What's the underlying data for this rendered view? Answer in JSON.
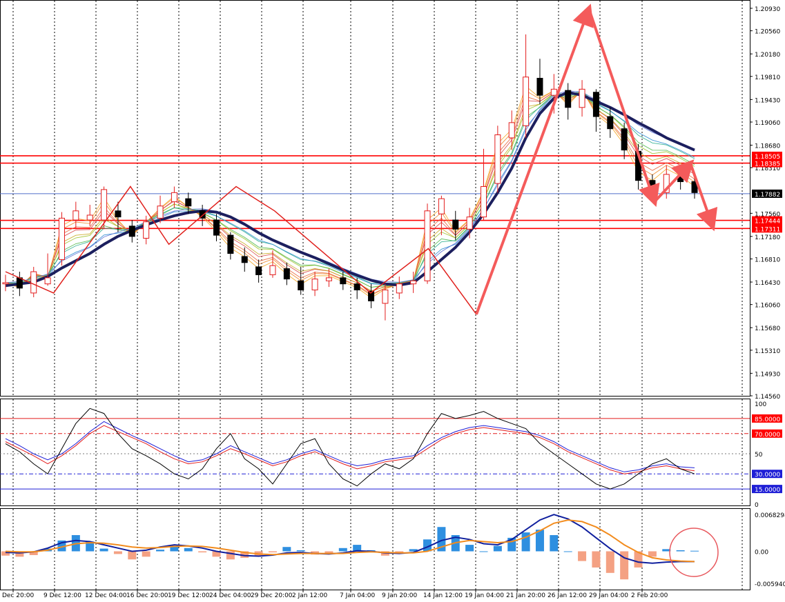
{
  "colors": {
    "background": "#ffffff",
    "panel_border": "#000000",
    "grid": "#000000",
    "resistance_line": "#ff0000",
    "price_line": "#4f6cc9",
    "trend_ma": "#1c1f5e",
    "pattern_lines": "#e0201c",
    "forecast_arrows": "#f45b5b",
    "bull_candle": "#e31b1b",
    "bear_candle": "#000000",
    "macd_positive_hist": "#2e8fe0",
    "macd_negative_hist": "#f4a183",
    "macd_line": "#0f1f9e",
    "signal_line": "#f28c1e",
    "stoch_main": "#000000",
    "stoch_blue": "#1e1ed6",
    "stoch_red": "#e31b1b",
    "highlight_circle": "#e8585d"
  },
  "price_axis": {
    "ticks": [
      "1.20930",
      "1.20560",
      "1.20180",
      "1.19810",
      "1.19430",
      "1.19060",
      "1.18680",
      "1.18310",
      "1.17560",
      "1.17180",
      "1.16810",
      "1.16430",
      "1.16060",
      "1.15680",
      "1.15310",
      "1.14930",
      "1.14560"
    ],
    "min": 1.1456,
    "max": 1.2093
  },
  "level_labels": [
    {
      "value": 1.18505,
      "text": "1.18505",
      "bg": "#ff0000",
      "fg": "#ffffff"
    },
    {
      "value": 1.18385,
      "text": "1.18385",
      "bg": "#ff0000",
      "fg": "#ffffff"
    },
    {
      "value": 1.17882,
      "text": "1.17882",
      "bg": "#000000",
      "fg": "#ffffff"
    },
    {
      "value": 1.17444,
      "text": "1.17444",
      "bg": "#ff0000",
      "fg": "#ffffff"
    },
    {
      "value": 1.17311,
      "text": "1.17311",
      "bg": "#ff0000",
      "fg": "#ffffff"
    }
  ],
  "stoch_axis": {
    "ticks": [
      "100",
      "50",
      "0"
    ],
    "levels": [
      {
        "value": 85,
        "text": "85.0000",
        "bg": "#ff0000",
        "fg": "#ffffff"
      },
      {
        "value": 70,
        "text": "70.0000",
        "bg": "#ff0000",
        "fg": "#ffffff"
      },
      {
        "value": 30,
        "text": "30.0000",
        "bg": "#1e1ed6",
        "fg": "#ffffff"
      },
      {
        "value": 15,
        "text": "15.0000",
        "bg": "#1e1ed6",
        "fg": "#ffffff"
      }
    ]
  },
  "macd_axis": {
    "ticks": [
      "0.0068298",
      "0.00",
      "-0.005940"
    ],
    "max": 0.0068298,
    "min": -0.00594
  },
  "time_axis": {
    "labels": [
      "Dec 20:00",
      "9 Dec 12:00",
      "12 Dec 04:00",
      "16 Dec 20:00",
      "19 Dec 12:00",
      "24 Dec 04:00",
      "29 Dec 20:00",
      "2 Jan 12:00",
      "7 Jan 04:00",
      "9 Jan 20:00",
      "14 Jan 12:00",
      "19 Jan 04:00",
      "21 Jan 20:00",
      "26 Jan 12:00",
      "29 Jan 04:00",
      "2 Feb 20:00"
    ]
  },
  "chart_data": [
    {
      "type": "candlestick",
      "series": [
        {
          "name": "",
          "values": [
            [
              1.164,
              1.1642,
              1.1655,
              1.1628
            ],
            [
              1.165,
              1.1633,
              1.166,
              1.162
            ],
            [
              1.1625,
              1.166,
              1.1668,
              1.1618
            ],
            [
              1.164,
              1.165,
              1.169,
              1.1637
            ],
            [
              1.168,
              1.1748,
              1.1758,
              1.167
            ],
            [
              1.1745,
              1.176,
              1.1775,
              1.1732
            ],
            [
              1.1745,
              1.1753,
              1.177,
              1.1735
            ],
            [
              1.1745,
              1.1795,
              1.18,
              1.173
            ],
            [
              1.176,
              1.175,
              1.1775,
              1.1725
            ],
            [
              1.1735,
              1.1718,
              1.1745,
              1.1708
            ],
            [
              1.1715,
              1.1742,
              1.1752,
              1.1705
            ],
            [
              1.1748,
              1.1768,
              1.1785,
              1.174
            ],
            [
              1.1775,
              1.179,
              1.18,
              1.1765
            ],
            [
              1.178,
              1.1768,
              1.179,
              1.1755
            ],
            [
              1.176,
              1.1748,
              1.177,
              1.1735
            ],
            [
              1.1745,
              1.172,
              1.1755,
              1.171
            ],
            [
              1.172,
              1.169,
              1.1725,
              1.168
            ],
            [
              1.1685,
              1.1675,
              1.17,
              1.166
            ],
            [
              1.1668,
              1.1655,
              1.168,
              1.1642
            ],
            [
              1.1655,
              1.167,
              1.1695,
              1.165
            ],
            [
              1.1665,
              1.1648,
              1.1675,
              1.1638
            ],
            [
              1.1645,
              1.163,
              1.1668,
              1.1622
            ],
            [
              1.163,
              1.1648,
              1.166,
              1.162
            ],
            [
              1.1645,
              1.165,
              1.1665,
              1.1635
            ],
            [
              1.165,
              1.164,
              1.166,
              1.163
            ],
            [
              1.164,
              1.163,
              1.165,
              1.1615
            ],
            [
              1.1628,
              1.1612,
              1.164,
              1.16
            ],
            [
              1.1608,
              1.163,
              1.164,
              1.158
            ],
            [
              1.1625,
              1.164,
              1.1652,
              1.1615
            ],
            [
              1.164,
              1.1645,
              1.166,
              1.1625
            ],
            [
              1.1645,
              1.176,
              1.1772,
              1.164
            ],
            [
              1.1755,
              1.178,
              1.1785,
              1.172
            ],
            [
              1.1745,
              1.173,
              1.176,
              1.1712
            ],
            [
              1.173,
              1.175,
              1.1765,
              1.1715
            ],
            [
              1.175,
              1.18,
              1.1862,
              1.1745
            ],
            [
              1.1805,
              1.1885,
              1.19,
              1.179
            ],
            [
              1.188,
              1.1905,
              1.1925,
              1.186
            ],
            [
              1.19,
              1.198,
              1.205,
              1.188
            ],
            [
              1.1978,
              1.195,
              1.201,
              1.1935
            ],
            [
              1.195,
              1.196,
              1.1985,
              1.192
            ],
            [
              1.1958,
              1.193,
              1.197,
              1.191
            ],
            [
              1.193,
              1.196,
              1.1975,
              1.1915
            ],
            [
              1.1955,
              1.1915,
              1.196,
              1.189
            ],
            [
              1.1915,
              1.1895,
              1.193,
              1.188
            ],
            [
              1.1895,
              1.186,
              1.1905,
              1.1845
            ],
            [
              1.1858,
              1.181,
              1.187,
              1.1795
            ],
            [
              1.181,
              1.1795,
              1.182,
              1.1775
            ],
            [
              1.179,
              1.182,
              1.1835,
              1.178
            ],
            [
              1.1818,
              1.1808,
              1.1832,
              1.1795
            ],
            [
              1.1808,
              1.179,
              1.1818,
              1.178
            ]
          ]
        }
      ]
    },
    {
      "type": "line",
      "series": [
        {
          "name": "",
          "values": [
            1.1637,
            1.164,
            1.1643,
            1.1652,
            1.1666,
            1.1678,
            1.169,
            1.1705,
            1.1718,
            1.1728,
            1.1737,
            1.1745,
            1.1752,
            1.1757,
            1.176,
            1.1758,
            1.175,
            1.1738,
            1.1724,
            1.1712,
            1.1702,
            1.1692,
            1.1683,
            1.1673,
            1.1663,
            1.1654,
            1.1646,
            1.164,
            1.1638,
            1.1642,
            1.166,
            1.168,
            1.17,
            1.1725,
            1.1755,
            1.179,
            1.183,
            1.188,
            1.192,
            1.1945,
            1.1955,
            1.195,
            1.194,
            1.193,
            1.1918,
            1.1905,
            1.1893,
            1.188,
            1.187,
            1.186
          ]
        }
      ]
    },
    {
      "type": "line",
      "series": [
        {
          "name": "",
          "values": [
            62,
            55,
            48,
            40,
            48,
            58,
            70,
            78,
            72,
            66,
            60,
            52,
            45,
            40,
            42,
            48,
            55,
            50,
            44,
            38,
            42,
            48,
            52,
            46,
            40,
            35,
            38,
            42,
            44,
            46,
            55,
            64,
            70,
            74,
            76,
            74,
            72,
            70,
            66,
            60,
            52,
            46,
            40,
            34,
            30,
            32,
            36,
            38,
            35,
            33
          ]
        },
        {
          "name": "",
          "values": [
            65,
            58,
            50,
            44,
            50,
            60,
            72,
            82,
            75,
            68,
            62,
            55,
            48,
            42,
            44,
            50,
            58,
            52,
            46,
            40,
            44,
            50,
            54,
            48,
            42,
            38,
            40,
            44,
            46,
            48,
            58,
            66,
            72,
            76,
            78,
            76,
            74,
            72,
            68,
            62,
            54,
            48,
            42,
            36,
            32,
            34,
            38,
            40,
            37,
            36
          ]
        },
        {
          "name": "",
          "values": [
            60,
            52,
            40,
            30,
            55,
            80,
            95,
            90,
            70,
            55,
            48,
            40,
            30,
            25,
            35,
            55,
            70,
            45,
            35,
            20,
            40,
            60,
            65,
            40,
            25,
            18,
            30,
            40,
            35,
            45,
            70,
            90,
            85,
            88,
            92,
            85,
            80,
            75,
            60,
            50,
            40,
            30,
            20,
            15,
            20,
            30,
            40,
            45,
            35,
            30
          ]
        }
      ]
    },
    {
      "type": "bar",
      "series": [
        {
          "name": "",
          "values": [
            -0.0008,
            -0.001,
            -0.0007,
            0.0005,
            0.002,
            0.003,
            0.0018,
            0.0005,
            -0.0005,
            -0.0015,
            -0.001,
            0.0003,
            0.001,
            0.0006,
            -0.0002,
            -0.001,
            -0.0015,
            -0.0012,
            -0.0008,
            -0.0002,
            0.0008,
            0.0002,
            -0.0006,
            -0.0004,
            0.0006,
            0.0012,
            0.0002,
            -0.0008,
            -0.0004,
            0.0004,
            0.0022,
            0.0045,
            0.003,
            0.0012,
            0.0,
            0.001,
            0.0025,
            0.0035,
            0.004,
            0.003,
            0.0,
            -0.0018,
            -0.003,
            -0.004,
            -0.0052,
            -0.003,
            -0.001,
            0.0004,
            0.0002,
            0.0001
          ]
        }
      ]
    },
    {
      "type": "line",
      "series": [
        {
          "name": "",
          "values": [
            -0.0002,
            -0.0003,
            -0.0001,
            0.0006,
            0.0016,
            0.002,
            0.0018,
            0.0012,
            0.0006,
            0.0,
            0.0002,
            0.0008,
            0.0012,
            0.001,
            0.0006,
            0.0,
            -0.0004,
            -0.0008,
            -0.0009,
            -0.0007,
            -0.0003,
            -0.0002,
            -0.0004,
            -0.0005,
            -0.0003,
            0.0001,
            0.0,
            -0.0003,
            -0.0004,
            -0.0002,
            0.0008,
            0.002,
            0.0026,
            0.0022,
            0.0014,
            0.0012,
            0.0022,
            0.004,
            0.0058,
            0.0068,
            0.006,
            0.0045,
            0.0025,
            0.0005,
            -0.0012,
            -0.002,
            -0.0022,
            -0.002,
            -0.0019,
            -0.0019
          ]
        },
        {
          "name": "",
          "values": [
            0.0,
            -0.0001,
            -0.0001,
            0.0002,
            0.0008,
            0.0014,
            0.0016,
            0.0015,
            0.0012,
            0.0008,
            0.0006,
            0.0007,
            0.0009,
            0.001,
            0.0009,
            0.0006,
            0.0002,
            -0.0002,
            -0.0005,
            -0.0006,
            -0.0005,
            -0.0004,
            -0.0004,
            -0.0004,
            -0.0004,
            -0.0002,
            -0.0001,
            -0.0002,
            -0.0003,
            -0.0003,
            0.0,
            0.0008,
            0.0016,
            0.002,
            0.0018,
            0.0016,
            0.0018,
            0.0026,
            0.0038,
            0.0052,
            0.0058,
            0.0055,
            0.0045,
            0.003,
            0.0012,
            -0.0002,
            -0.0012,
            -0.0016,
            -0.0018,
            -0.0019
          ]
        }
      ]
    }
  ]
}
